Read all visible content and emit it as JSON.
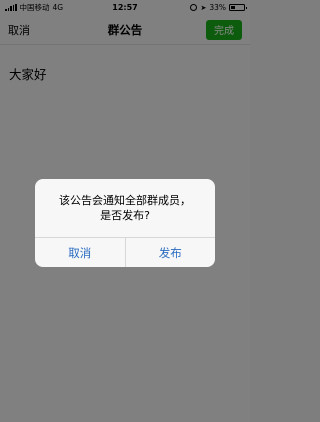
{
  "status_bar": {
    "carrier": "中国移动",
    "network": "4G",
    "time": "12:57",
    "battery_percent": "33%",
    "battery_level": 0.33
  },
  "nav": {
    "cancel_label": "取消",
    "title": "群公告",
    "done_label": "完成",
    "done_color": "#1aad19"
  },
  "content": {
    "announcement_text": "大家好"
  },
  "dialog": {
    "message": "该公告会通知全部群成员，\n是否发布?",
    "cancel_label": "取消",
    "publish_label": "发布",
    "button_color": "#2a6cc1"
  }
}
